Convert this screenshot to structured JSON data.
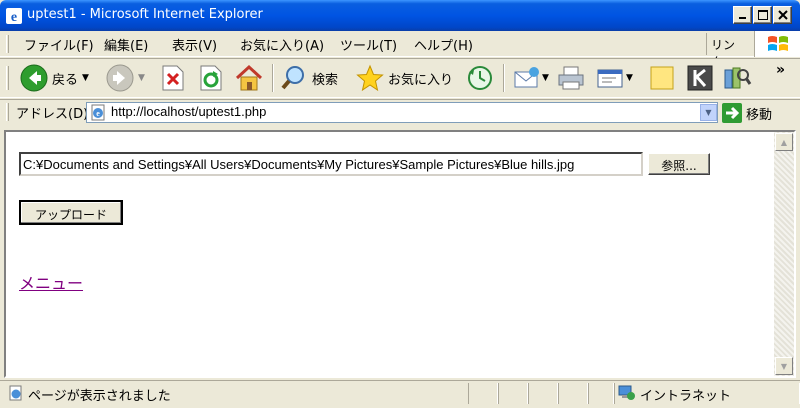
{
  "window": {
    "title": "uptest1 - Microsoft Internet Explorer"
  },
  "menu": {
    "items": [
      "ファイル(F)",
      "編集(E)",
      "表示(V)",
      "お気に入り(A)",
      "ツール(T)",
      "ヘルプ(H)"
    ],
    "links_label": "リンク"
  },
  "toolbar": {
    "back_label": "戻る",
    "search_label": "検索",
    "favorites_label": "お気に入り",
    "more_label": "»"
  },
  "address": {
    "label": "アドレス(D)",
    "url": "http://localhost/uptest1.php",
    "go_label": "移動"
  },
  "form": {
    "file_value": "C:¥Documents and Settings¥All Users¥Documents¥My Pictures¥Sample Pictures¥Blue hills.jpg",
    "browse_label": "参照...",
    "upload_label": "アップロード"
  },
  "content": {
    "menu_link": "メニュー"
  },
  "status": {
    "text": "ページが表示されました",
    "zone": "イントラネット"
  }
}
